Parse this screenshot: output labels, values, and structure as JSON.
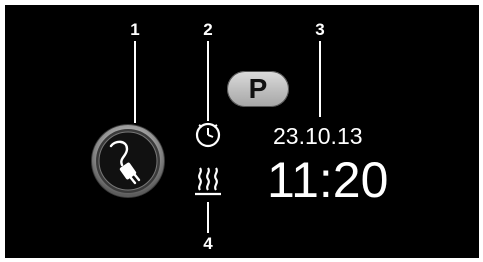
{
  "callouts": {
    "one": "1",
    "two": "2",
    "three": "3",
    "four": "4"
  },
  "gear": {
    "label": "P"
  },
  "status": {
    "date": "23.10.13",
    "time": "11:20"
  },
  "icons": {
    "charging": "plug-icon",
    "timer": "clock-icon",
    "climate": "heat-waves-icon"
  },
  "colors": {
    "background": "#000000",
    "foreground": "#ffffff",
    "gear_button": "#bdbdbd"
  }
}
